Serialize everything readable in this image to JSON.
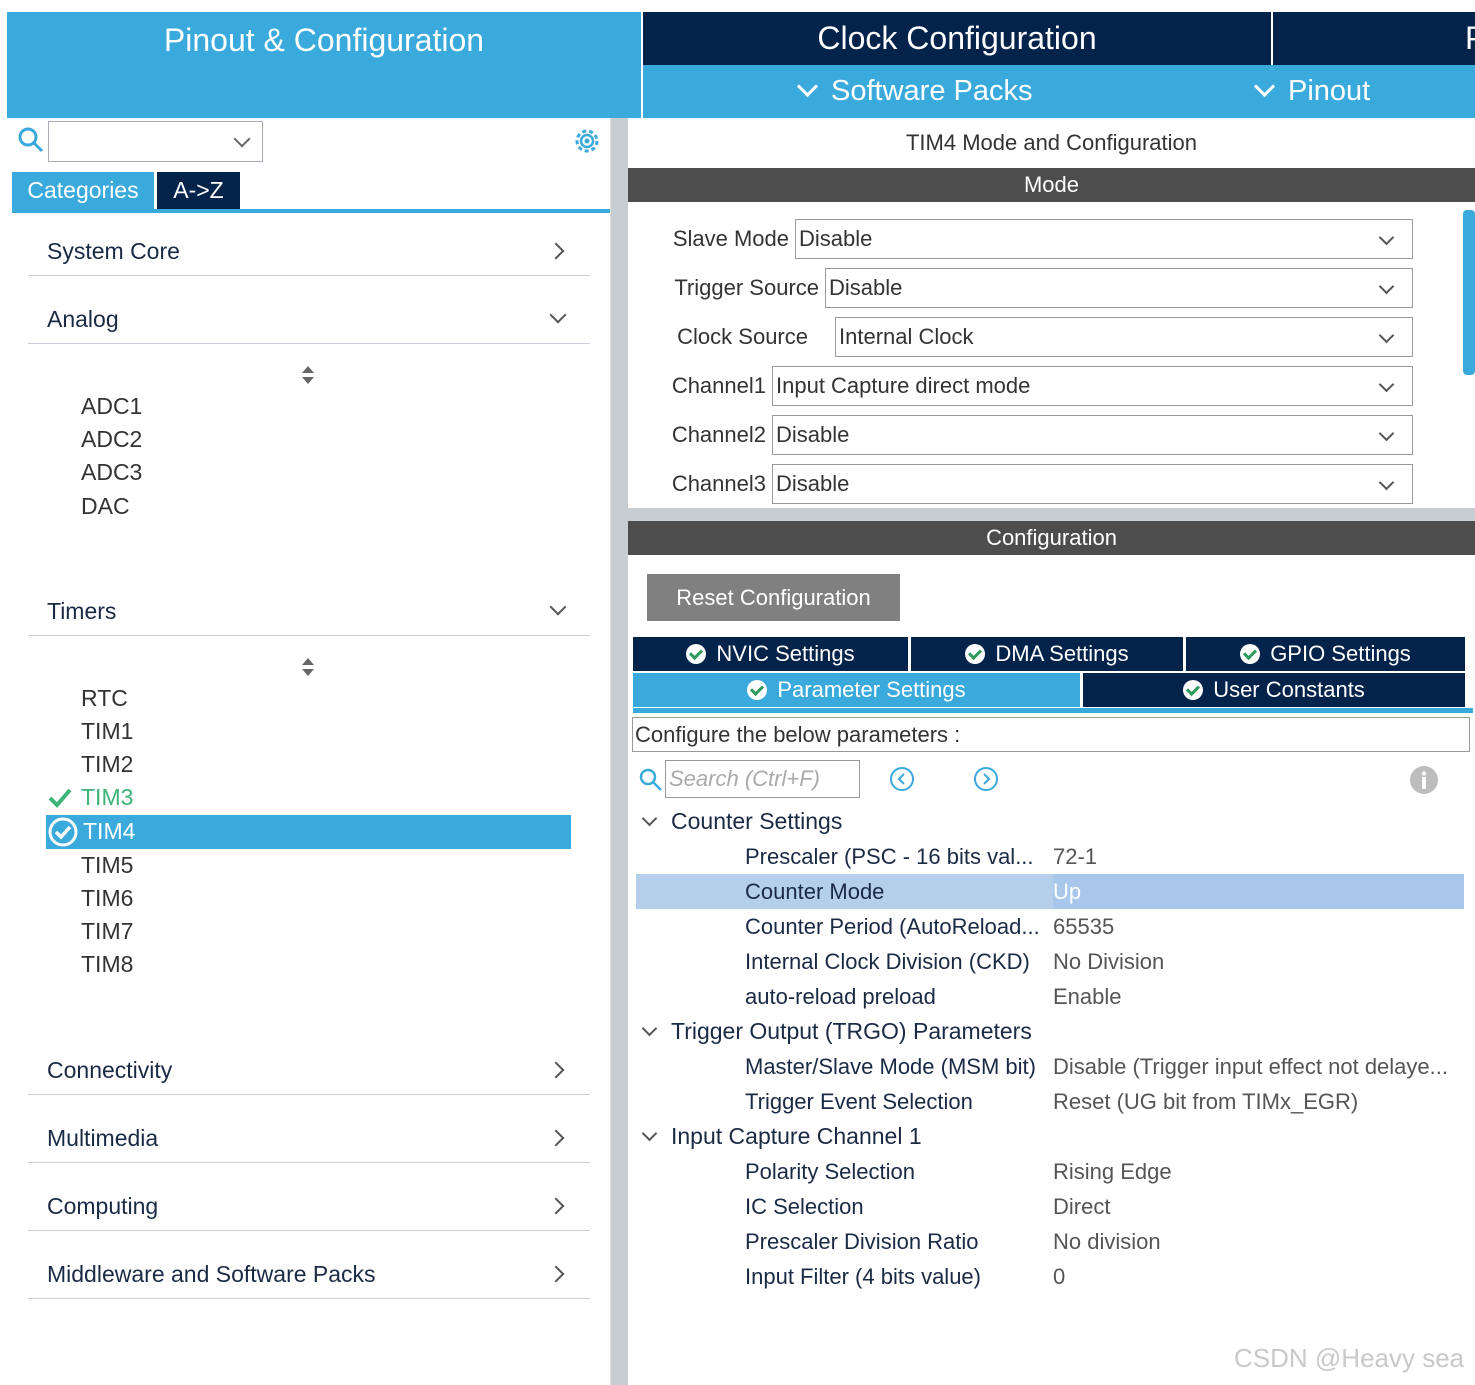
{
  "top_tabs": {
    "pinout": "Pinout & Configuration",
    "clock": "Clock Configuration",
    "extra": "P",
    "software_packs": "Software Packs",
    "pinout_menu": "Pinout"
  },
  "left": {
    "tabs": {
      "categories": "Categories",
      "az": "A->Z"
    },
    "categories": [
      {
        "label": "System Core"
      },
      {
        "label": "Analog"
      },
      {
        "label": "Timers"
      },
      {
        "label": "Connectivity"
      },
      {
        "label": "Multimedia"
      },
      {
        "label": "Computing"
      },
      {
        "label": "Middleware and Software Packs"
      }
    ],
    "analog_items": [
      "ADC1",
      "ADC2",
      "ADC3",
      "DAC"
    ],
    "timer_items": [
      "RTC",
      "TIM1",
      "TIM2",
      "TIM3",
      "TIM4",
      "TIM5",
      "TIM6",
      "TIM7",
      "TIM8"
    ]
  },
  "right": {
    "title": "TIM4 Mode and Configuration",
    "mode_header": "Mode",
    "mode_fields": [
      {
        "label": "Slave Mode",
        "value": "Disable"
      },
      {
        "label": "Trigger Source",
        "value": "Disable"
      },
      {
        "label": "Clock Source",
        "value": "Internal Clock"
      },
      {
        "label": "Channel1",
        "value": "Input Capture direct mode"
      },
      {
        "label": "Channel2",
        "value": "Disable"
      },
      {
        "label": "Channel3",
        "value": "Disable"
      }
    ],
    "config_header": "Configuration",
    "reset_button": "Reset Configuration",
    "settings_tabs": {
      "nvic": "NVIC Settings",
      "dma": "DMA Settings",
      "gpio": "GPIO Settings",
      "param": "Parameter Settings",
      "user": "User Constants"
    },
    "configure_text": "Configure the below parameters :",
    "search_placeholder": "Search (Ctrl+F)",
    "groups": [
      {
        "name": "Counter Settings",
        "params": [
          {
            "name": "Prescaler (PSC - 16 bits val...",
            "value": "72-1"
          },
          {
            "name": "Counter Mode",
            "value": "Up"
          },
          {
            "name": "Counter Period (AutoReload...",
            "value": "65535"
          },
          {
            "name": "Internal Clock Division (CKD)",
            "value": "No Division"
          },
          {
            "name": "auto-reload preload",
            "value": "Enable"
          }
        ]
      },
      {
        "name": "Trigger Output (TRGO) Parameters",
        "params": [
          {
            "name": "Master/Slave Mode (MSM bit)",
            "value": "Disable (Trigger input effect not delaye..."
          },
          {
            "name": "Trigger Event Selection",
            "value": "Reset (UG bit from TIMx_EGR)"
          }
        ]
      },
      {
        "name": "Input Capture Channel 1",
        "params": [
          {
            "name": "Polarity Selection",
            "value": "Rising Edge"
          },
          {
            "name": "IC Selection",
            "value": "Direct"
          },
          {
            "name": "Prescaler Division Ratio",
            "value": "No division"
          },
          {
            "name": "Input Filter (4 bits value)",
            "value": "0"
          }
        ]
      }
    ]
  },
  "watermark": "CSDN @Heavy sea",
  "colors": {
    "accent": "#3aa9dc",
    "dark": "#03234b",
    "header": "#4d4d4d",
    "ok": "#3cb47a",
    "selected_row": "#b5cfea"
  }
}
